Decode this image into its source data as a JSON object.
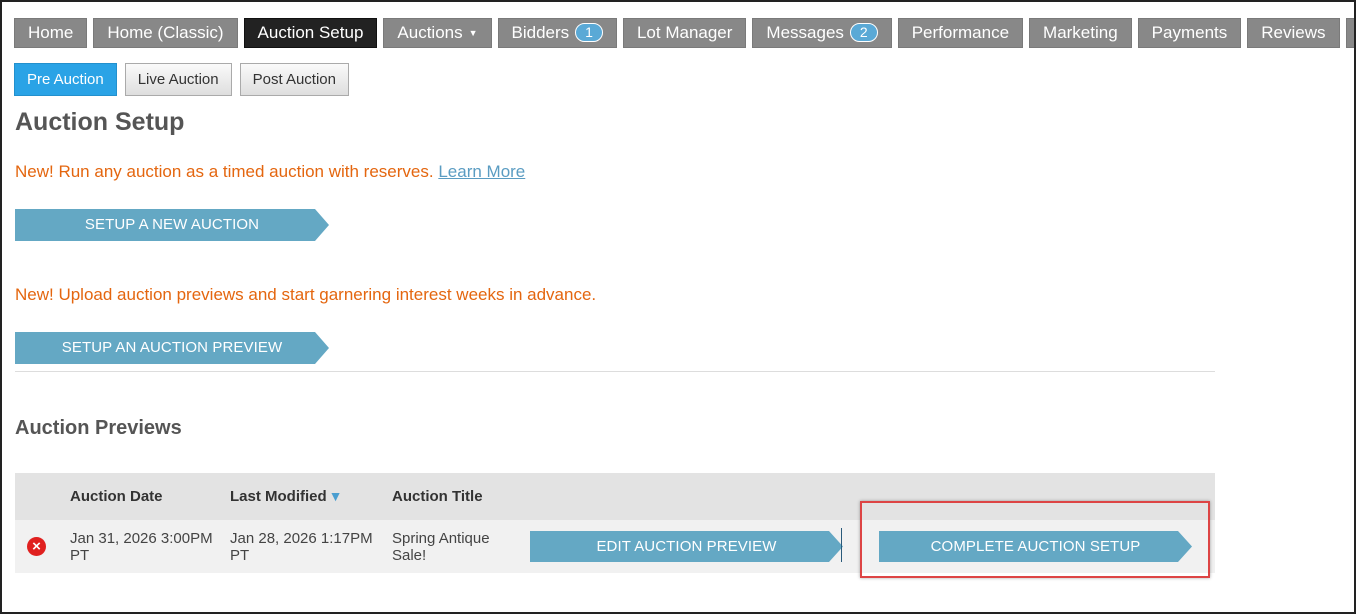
{
  "nav": {
    "tabs": [
      {
        "label": "Home"
      },
      {
        "label": "Home (Classic)"
      },
      {
        "label": "Auction Setup",
        "active": true
      },
      {
        "label": "Auctions"
      },
      {
        "label": "Bidders",
        "badge": "1"
      },
      {
        "label": "Lot Manager"
      },
      {
        "label": "Messages",
        "badge": "2"
      },
      {
        "label": "Performance"
      },
      {
        "label": "Marketing"
      },
      {
        "label": "Payments"
      },
      {
        "label": "Reviews"
      },
      {
        "label": "C"
      }
    ]
  },
  "subnav": {
    "pre": "Pre Auction",
    "live": "Live Auction",
    "post": "Post Auction"
  },
  "page": {
    "title": "Auction Setup",
    "promo1_text": "New! Run any auction as a timed auction with reserves.",
    "promo1_link": "Learn More",
    "setup_new_label": "SETUP A NEW AUCTION",
    "promo2_text": "New! Upload auction previews and start garnering interest weeks in advance.",
    "setup_preview_label": "SETUP AN AUCTION PREVIEW"
  },
  "previews": {
    "title": "Auction Previews",
    "columns": {
      "date": "Auction Date",
      "modified": "Last Modified",
      "title": "Auction Title"
    },
    "rows": [
      {
        "date_line1": "Jan 31, 2026 3:00PM",
        "date_line2": "PT",
        "modified_line1": "Jan 28, 2026 1:17PM",
        "modified_line2": "PT",
        "title_line1": "Spring Antique",
        "title_line2": "Sale!",
        "edit_label": "EDIT AUCTION PREVIEW",
        "complete_label": "COMPLETE AUCTION SETUP"
      }
    ]
  },
  "colors": {
    "accent": "#64a8c4",
    "promo": "#e4660f",
    "active_tab": "#222222",
    "highlight": "#dd4444"
  }
}
